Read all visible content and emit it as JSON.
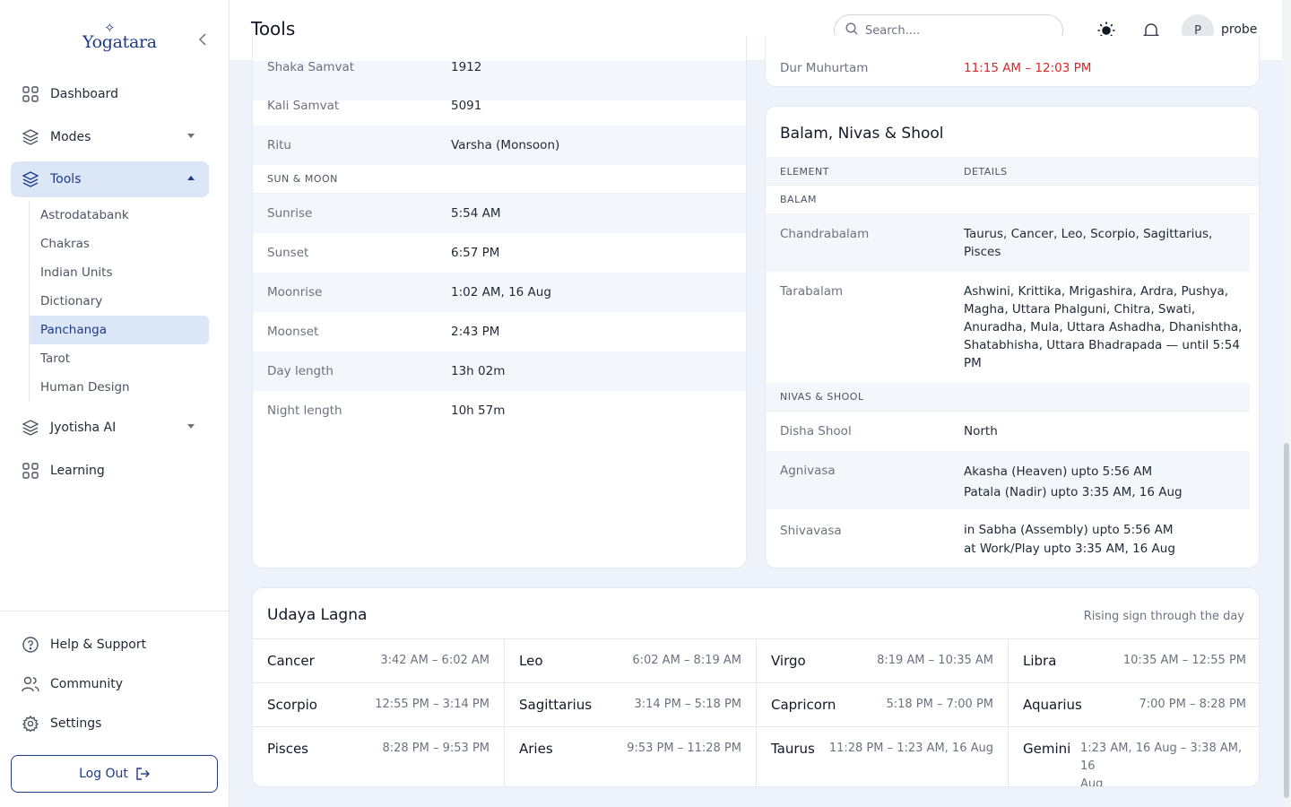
{
  "brand": {
    "name": "Yogatara"
  },
  "sidebar": {
    "nav": [
      {
        "label": "Dashboard"
      },
      {
        "label": "Modes"
      },
      {
        "label": "Tools"
      },
      {
        "label": "Jyotisha AI"
      },
      {
        "label": "Learning"
      }
    ],
    "tools_sub": [
      "Astrodatabank",
      "Chakras",
      "Indian Units",
      "Dictionary",
      "Panchanga",
      "Tarot",
      "Human Design"
    ],
    "footer": [
      {
        "label": "Help & Support"
      },
      {
        "label": "Community"
      },
      {
        "label": "Settings"
      }
    ],
    "logout": "Log Out"
  },
  "header": {
    "title": "Tools",
    "search_placeholder": "Search....",
    "avatar_initial": "P",
    "username": "probe"
  },
  "panchanga": {
    "rows_top": [
      {
        "key": "Shaka Samvat",
        "value": "1912"
      },
      {
        "key": "Kali Samvat",
        "value": "5091"
      },
      {
        "key": "Ritu",
        "value": "Varsha (Monsoon)"
      }
    ],
    "sun_moon_heading": "SUN & MOON",
    "sun_moon": [
      {
        "key": "Sunrise",
        "value": "5:54 AM"
      },
      {
        "key": "Sunset",
        "value": "6:57 PM"
      },
      {
        "key": "Moonrise",
        "value": "1:02 AM, 16 Aug"
      },
      {
        "key": "Moonset",
        "value": "2:43 PM"
      },
      {
        "key": "Day length",
        "value": "13h 02m"
      },
      {
        "key": "Night length",
        "value": "10h 57m"
      }
    ]
  },
  "muhurtam": {
    "key": "Dur Muhurtam",
    "value": "11:15 AM – 12:03 PM",
    "value_color": "#dc2626"
  },
  "balam": {
    "title": "Balam, Nivas & Shool",
    "col_element": "ELEMENT",
    "col_details": "DETAILS",
    "balam_heading": "BALAM",
    "chandrabalam": {
      "key": "Chandrabalam",
      "value": [
        "Taurus, Cancer, Leo, Scorpio, Sagittarius,",
        "Pisces"
      ]
    },
    "tarabalam": {
      "key": "Tarabalam",
      "value": [
        "Ashwini, Krittika, Mrigashira, Ardra, Pushya,",
        "Magha, Uttara Phalguni, Chitra, Swati,",
        "Anuradha, Mula, Uttara Ashadha, Dhanishtha,",
        "Shatabhisha, Uttara Bhadrapada — until 5:54",
        "PM"
      ]
    },
    "nivas_heading": "NIVAS & SHOOL",
    "disha": {
      "key": "Disha Shool",
      "value": "North"
    },
    "agnivasa": {
      "key": "Agnivasa",
      "value": [
        "Akasha (Heaven) upto 5:56 AM",
        "Patala (Nadir) upto 3:35 AM, 16 Aug"
      ]
    },
    "shivavasa": {
      "key": "Shivavasa",
      "value": [
        "in Sabha (Assembly) upto 5:56 AM",
        "at Work/Play upto 3:35 AM, 16 Aug"
      ]
    }
  },
  "lagna": {
    "title": "Udaya Lagna",
    "subtitle": "Rising sign through the day",
    "cells": [
      {
        "sign": "Cancer",
        "time": [
          "3:42 AM – 6:02 AM"
        ]
      },
      {
        "sign": "Leo",
        "time": [
          "6:02 AM – 8:19 AM"
        ]
      },
      {
        "sign": "Virgo",
        "time": [
          "8:19 AM – 10:35 AM"
        ]
      },
      {
        "sign": "Libra",
        "time": [
          "10:35 AM – 12:55 PM"
        ]
      },
      {
        "sign": "Scorpio",
        "time": [
          "12:55 PM – 3:14 PM"
        ]
      },
      {
        "sign": "Sagittarius",
        "time": [
          "3:14 PM – 5:18 PM"
        ]
      },
      {
        "sign": "Capricorn",
        "time": [
          "5:18 PM – 7:00 PM"
        ]
      },
      {
        "sign": "Aquarius",
        "time": [
          "7:00 PM – 8:28 PM"
        ]
      },
      {
        "sign": "Pisces",
        "time": [
          "8:28 PM – 9:53 PM"
        ]
      },
      {
        "sign": "Aries",
        "time": [
          "9:53 PM – 11:28 PM"
        ]
      },
      {
        "sign": "Taurus",
        "time": [
          "11:28 PM – 1:23 AM, 16 Aug"
        ]
      },
      {
        "sign": "Gemini",
        "time": [
          "1:23 AM, 16 Aug – 3:38 AM, 16",
          "Aug"
        ]
      }
    ]
  }
}
